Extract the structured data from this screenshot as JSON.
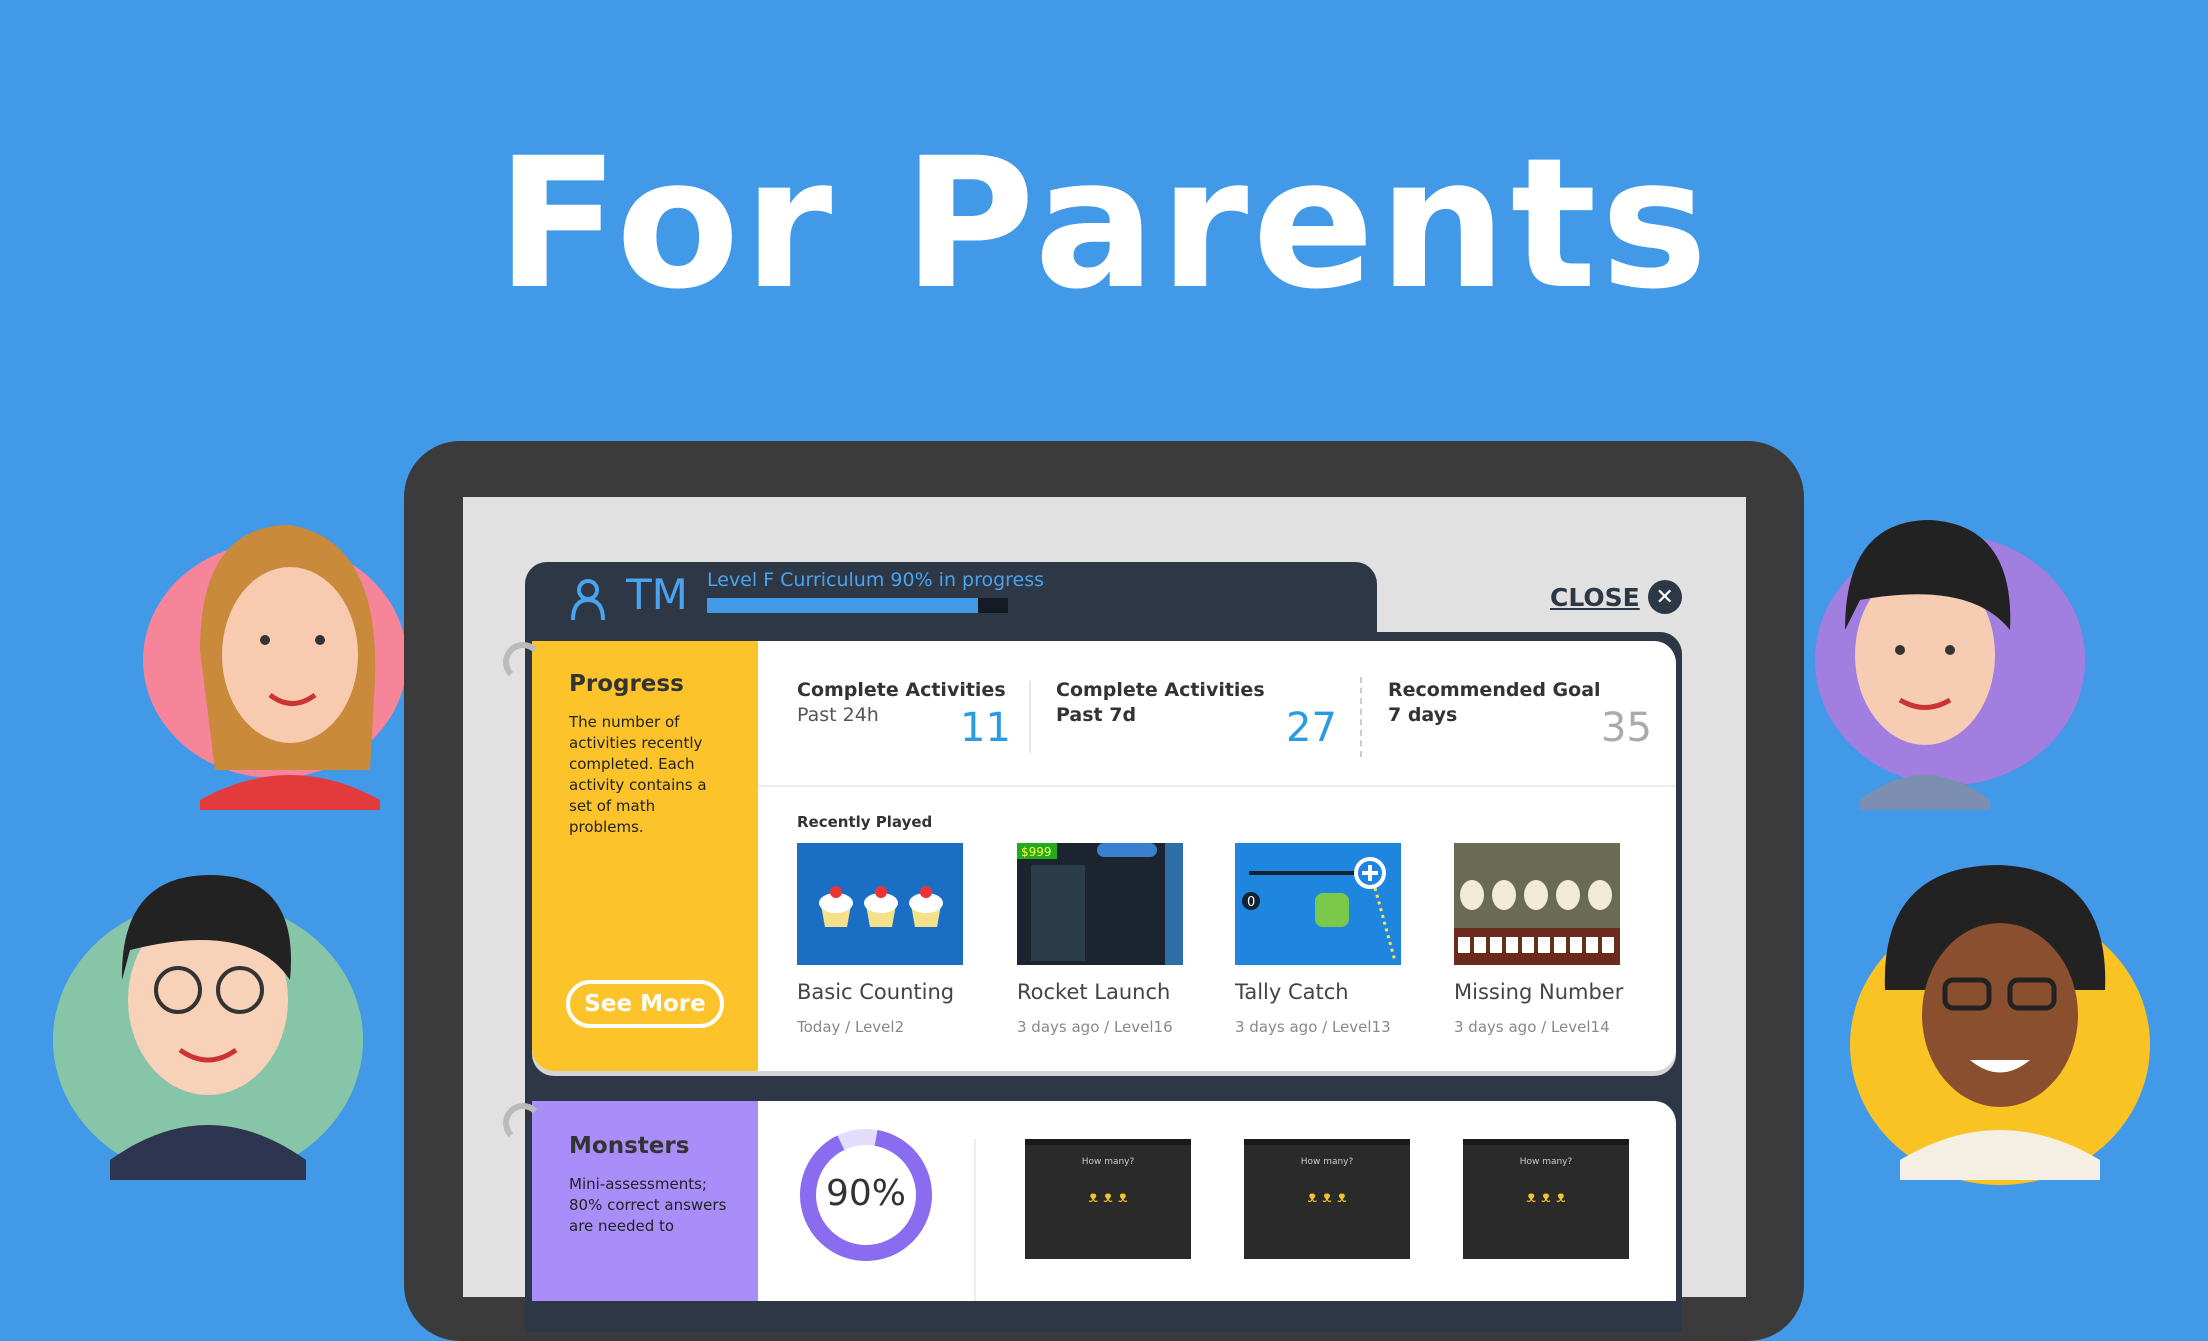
{
  "hero": {
    "title": "For Parents"
  },
  "header": {
    "initials": "TM",
    "curriculum": "Level F Curriculum 90% in progress",
    "progress_percent": 90,
    "close_label": "CLOSE"
  },
  "progress": {
    "title": "Progress",
    "description": "The number of activities recently completed. Each activity contains a set of math problems.",
    "see_more": "See More",
    "stats": [
      {
        "label": "Complete Activities",
        "period": "Past 24h",
        "value": "11"
      },
      {
        "label": "Complete Activities",
        "period": "Past 7d",
        "value": "27"
      },
      {
        "label": "Recommended Goal",
        "period": "7 days",
        "value": "35"
      }
    ],
    "recent_title": "Recently Played",
    "recent": [
      {
        "name": "Basic Counting",
        "meta": "Today / Level2"
      },
      {
        "name": "Rocket Launch",
        "meta": "3 days ago / Level16"
      },
      {
        "name": "Tally Catch",
        "meta": "3 days ago / Level13"
      },
      {
        "name": "Missing Number",
        "meta": "3 days ago / Level14"
      }
    ]
  },
  "monsters": {
    "title": "Monsters",
    "description": "Mini-assessments; 80% correct answers are needed to",
    "score": "90%",
    "score_value": 90,
    "thumb_caption": "How many?"
  },
  "colors": {
    "background": "#4199e8",
    "progress_side": "#fcc42a",
    "monsters_side": "#a98ef9",
    "accent": "#2a9be0",
    "panel": "#2d3745"
  }
}
